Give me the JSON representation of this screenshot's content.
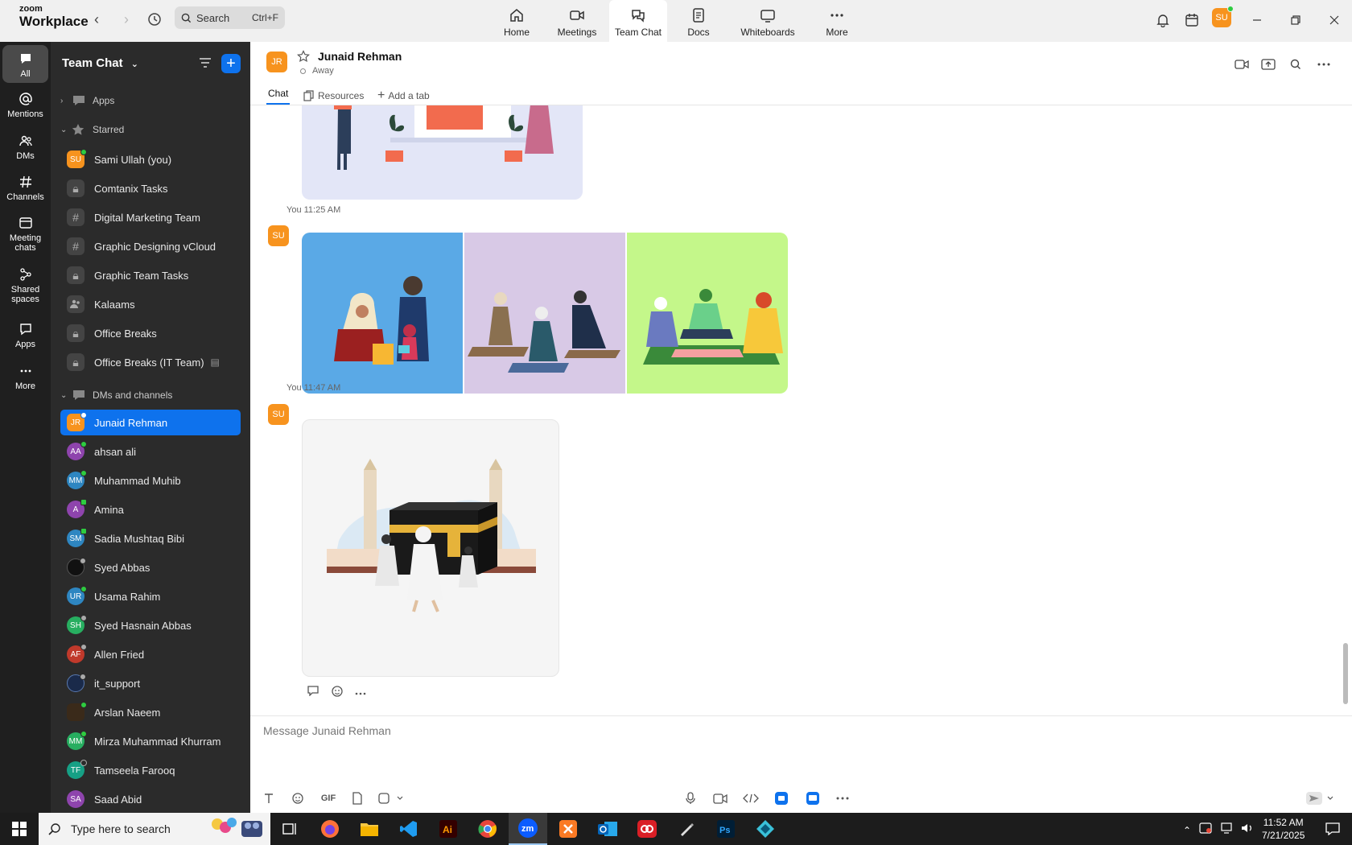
{
  "app": {
    "logo_top": "zoom",
    "logo_bottom": "Workplace"
  },
  "search": {
    "label": "Search",
    "shortcut": "Ctrl+F"
  },
  "tabs": [
    {
      "label": "Home",
      "icon": "home-icon"
    },
    {
      "label": "Meetings",
      "icon": "video-icon"
    },
    {
      "label": "Team Chat",
      "icon": "chat-icon"
    },
    {
      "label": "Docs",
      "icon": "doc-icon"
    },
    {
      "label": "Whiteboards",
      "icon": "whiteboard-icon"
    },
    {
      "label": "More",
      "icon": "more-icon"
    }
  ],
  "user": {
    "initials": "SU"
  },
  "rail": [
    {
      "label": "All"
    },
    {
      "label": "Mentions"
    },
    {
      "label": "DMs"
    },
    {
      "label": "Channels"
    },
    {
      "label": "Meeting chats"
    },
    {
      "label": "Shared spaces"
    },
    {
      "label": "Apps"
    },
    {
      "label": "More"
    }
  ],
  "sidebar": {
    "title": "Team Chat",
    "sections": {
      "apps": "Apps",
      "starred": "Starred",
      "dms": "DMs and channels"
    },
    "starred": [
      {
        "label": "Sami Ullah (you)",
        "initials": "SU",
        "kind": "avatar"
      },
      {
        "label": "Comtanix Tasks",
        "kind": "lock"
      },
      {
        "label": "Digital Marketing Team",
        "kind": "hash"
      },
      {
        "label": "Graphic Designing vCloud",
        "kind": "hash"
      },
      {
        "label": "Graphic Team Tasks",
        "kind": "lock"
      },
      {
        "label": "Kalaams",
        "kind": "people"
      },
      {
        "label": "Office Breaks",
        "kind": "lock"
      },
      {
        "label": "Office Breaks (IT Team)",
        "kind": "lock"
      }
    ],
    "dms": [
      {
        "label": "Junaid Rehman",
        "initials": "JR"
      },
      {
        "label": "ahsan ali",
        "initials": "AA"
      },
      {
        "label": "Muhammad Muhib",
        "initials": "MM"
      },
      {
        "label": "Amina",
        "initials": "A"
      },
      {
        "label": "Sadia Mushtaq Bibi",
        "initials": "SM"
      },
      {
        "label": "Syed Abbas",
        "initials": ""
      },
      {
        "label": "Usama Rahim",
        "initials": "UR"
      },
      {
        "label": "Syed Hasnain Abbas",
        "initials": "SH"
      },
      {
        "label": "Allen Fried",
        "initials": "AF"
      },
      {
        "label": "it_support",
        "initials": ""
      },
      {
        "label": "Arslan Naeem",
        "initials": ""
      },
      {
        "label": "Mirza Muhammad Khurram",
        "initials": "MM"
      },
      {
        "label": "Tamseela Farooq",
        "initials": "TF"
      },
      {
        "label": "Saad Abid",
        "initials": "SA"
      }
    ]
  },
  "chat": {
    "contact": {
      "initials": "JR",
      "name": "Junaid Rehman",
      "status": "Away"
    },
    "tabs": {
      "chat": "Chat",
      "resources": "Resources",
      "add": "Add a tab"
    },
    "messages": [
      {
        "sender": "You",
        "time": "11:25 AM",
        "avatar": "SU"
      },
      {
        "sender": "You",
        "time": "11:47 AM",
        "avatar": "SU"
      }
    ],
    "composer_placeholder": "Message Junaid Rehman",
    "gif_label": "GIF"
  },
  "taskbar": {
    "search_placeholder": "Type here to search",
    "time": "11:52 AM",
    "date": "7/21/2025",
    "apps": [
      "task-view",
      "firefox",
      "file-explorer",
      "vscode",
      "illustrator",
      "chrome",
      "zoom",
      "xampp",
      "outlook",
      "creative-cloud",
      "pen-tool",
      "photoshop",
      "app"
    ]
  },
  "colors": {
    "accent": "#0e72ed",
    "avatar_orange": "#f7931e",
    "online": "#2ecc40"
  }
}
